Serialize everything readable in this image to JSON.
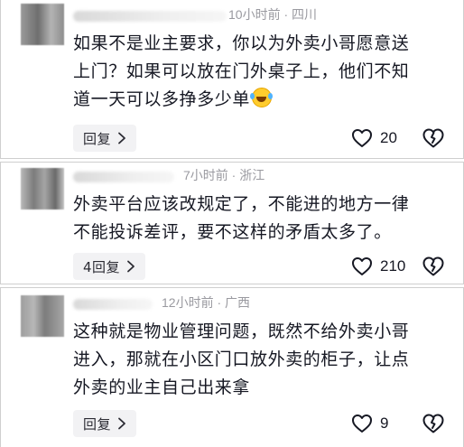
{
  "comments": [
    {
      "time": "10小时前",
      "location": "四川",
      "lines": [
        "如果不是业主要求，你以为外卖小哥愿意送",
        "上门？如果可以放在门外桌子上，他们不知",
        "道一天可以多挣多少单"
      ],
      "emoji_icon": "laughing-crying-emoji-icon",
      "reply_label": "回复",
      "likes": "20"
    },
    {
      "time": "7小时前",
      "location": "浙江",
      "lines": [
        "外卖平台应该改规定了，不能进的地方一律",
        "不能投诉差评，要不这样的矛盾太多了。"
      ],
      "reply_label": "4回复",
      "likes": "210"
    },
    {
      "time": "12小时前",
      "location": "广西",
      "lines": [
        "这种就是物业管理问题，既然不给外卖小哥",
        "进入，那就在小区门口放外卖的柜子，让点",
        "外卖的业主自己出来拿"
      ],
      "reply_label": "回复",
      "likes": "9"
    }
  ],
  "meta_separator": " · ",
  "icons": {
    "like": "heart-icon",
    "dislike": "broken-heart-icon",
    "chevron": "chevron-right-icon"
  },
  "colors": {
    "text": "#161823",
    "meta": "#9a9aa0",
    "reply_bg": "#f2f2f4"
  }
}
